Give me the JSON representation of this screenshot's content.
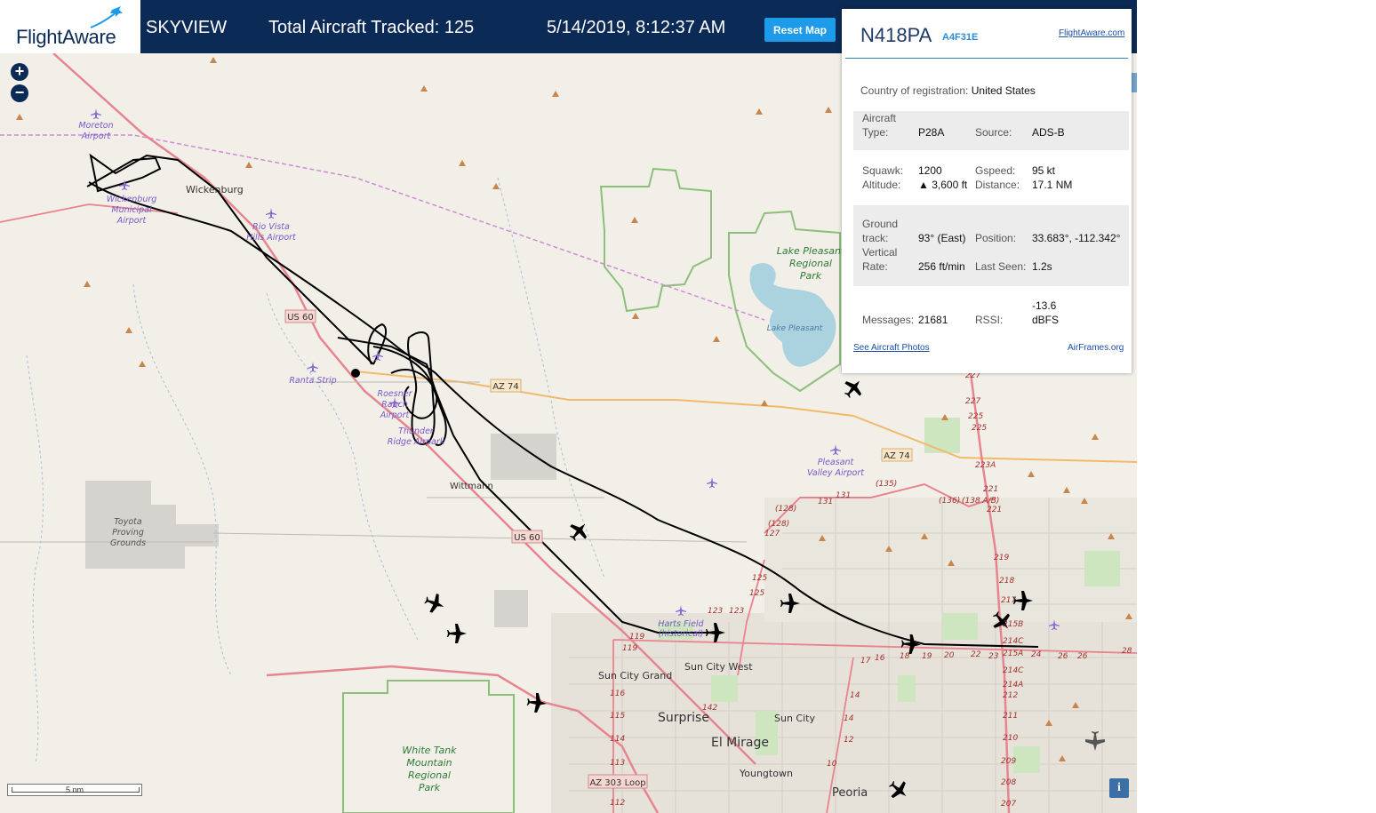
{
  "header": {
    "logo_text": "FlightAware",
    "app_name": "SKYVIEW",
    "total_tracked_label": "Total Aircraft Tracked:",
    "total_tracked_value": "125",
    "datetime": "5/14/2019, 8:12:37 AM",
    "reset_label": "Reset Map"
  },
  "map": {
    "zoom_in": "+",
    "zoom_out": "−",
    "scale_label": "5 nm",
    "info_label": "i",
    "places": [
      {
        "name": "Wickenburg",
        "kind": "town"
      },
      {
        "name": "Wittmann",
        "kind": "town"
      },
      {
        "name": "Surprise",
        "kind": "city"
      },
      {
        "name": "El Mirage",
        "kind": "city"
      },
      {
        "name": "Sun City",
        "kind": "town"
      },
      {
        "name": "Sun City West",
        "kind": "town"
      },
      {
        "name": "Sun City Grand",
        "kind": "town"
      },
      {
        "name": "Youngtown",
        "kind": "town"
      },
      {
        "name": "Peoria",
        "kind": "city"
      }
    ],
    "airports": [
      {
        "name": "Moreton Airport"
      },
      {
        "name": "Wickenburg Municipal Airport"
      },
      {
        "name": "Rio Vista Hills Airport"
      },
      {
        "name": "Ranta Strip"
      },
      {
        "name": "Roesner Ranch Airport"
      },
      {
        "name": "Thunder Ridge Airpark"
      },
      {
        "name": "Pleasant Valley Airport"
      },
      {
        "name": "Harts Field (historical)"
      }
    ],
    "parks": [
      {
        "name": "Lake Pleasant Regional Park"
      },
      {
        "name": "White Tank Mountain Regional Park"
      },
      {
        "name": "Toyota Proving Grounds"
      }
    ],
    "water": [
      {
        "name": "Lake Pleasant"
      }
    ],
    "road_shields": [
      "US 60",
      "AZ 74",
      "AZ 74",
      "US 60",
      "AZ 303 Loop"
    ],
    "road_numbers": [
      "227",
      "227",
      "225",
      "225",
      "223A",
      "221",
      "221",
      "219",
      "218",
      "217",
      "215B",
      "214C",
      "215A",
      "214C",
      "214A",
      "212",
      "211",
      "210",
      "209",
      "208",
      "207",
      "(135)",
      "(136)",
      "(138 A/B)",
      "131",
      "131",
      "(128)",
      "(128)",
      "127",
      "125",
      "125",
      "123",
      "123",
      "119",
      "119",
      "116",
      "115",
      "114",
      "113",
      "112",
      "142",
      "17",
      "16",
      "18",
      "19",
      "20",
      "22",
      "23",
      "24",
      "26",
      "26",
      "28",
      "14",
      "14",
      "12",
      "10"
    ]
  },
  "panel": {
    "ident": "N418PA",
    "hex": "A4F31E",
    "fa_link": "FlightAware.com",
    "country_label": "Country of registration:",
    "country_value": "United States",
    "aircraft_type_label": "Aircraft Type:",
    "aircraft_type_label_1": "Aircraft",
    "aircraft_type_label_2": "Type:",
    "aircraft_type_value": "P28A",
    "source_label": "Source:",
    "source_value": "ADS-B",
    "squawk_label": "Squawk:",
    "squawk_value": "1200",
    "gspeed_label": "Gspeed:",
    "gspeed_value": "95 kt",
    "altitude_label": "Altitude:",
    "altitude_value": "▲ 3,600 ft",
    "distance_label": "Distance:",
    "distance_value": "17.1 NM",
    "ground_track_label_1": "Ground",
    "ground_track_label_2": "track:",
    "ground_track_value": "93° (East)",
    "position_label": "Position:",
    "position_value": "33.683°, -112.342°",
    "vertical_rate_label_1": "Vertical",
    "vertical_rate_label_2": "Rate:",
    "vertical_rate_value": "256 ft/min",
    "last_seen_label": "Last Seen:",
    "last_seen_value": "1.2s",
    "messages_label": "Messages:",
    "messages_value": "21681",
    "rssi_label": "RSSI:",
    "rssi_value_1": "-13.6",
    "rssi_value_2": "dBFS",
    "photos_link": "See Aircraft Photos",
    "airframes_link": "AirFrames.org"
  },
  "colors": {
    "header_bg": "#0b2a55",
    "accent": "#1e9be8",
    "map_bg": "#f1efe8",
    "track": "#000000",
    "highway": "#e8848f",
    "state_road": "#f2b96b",
    "park_border": "#8cbf7a",
    "airspace": "#d08ad6"
  }
}
